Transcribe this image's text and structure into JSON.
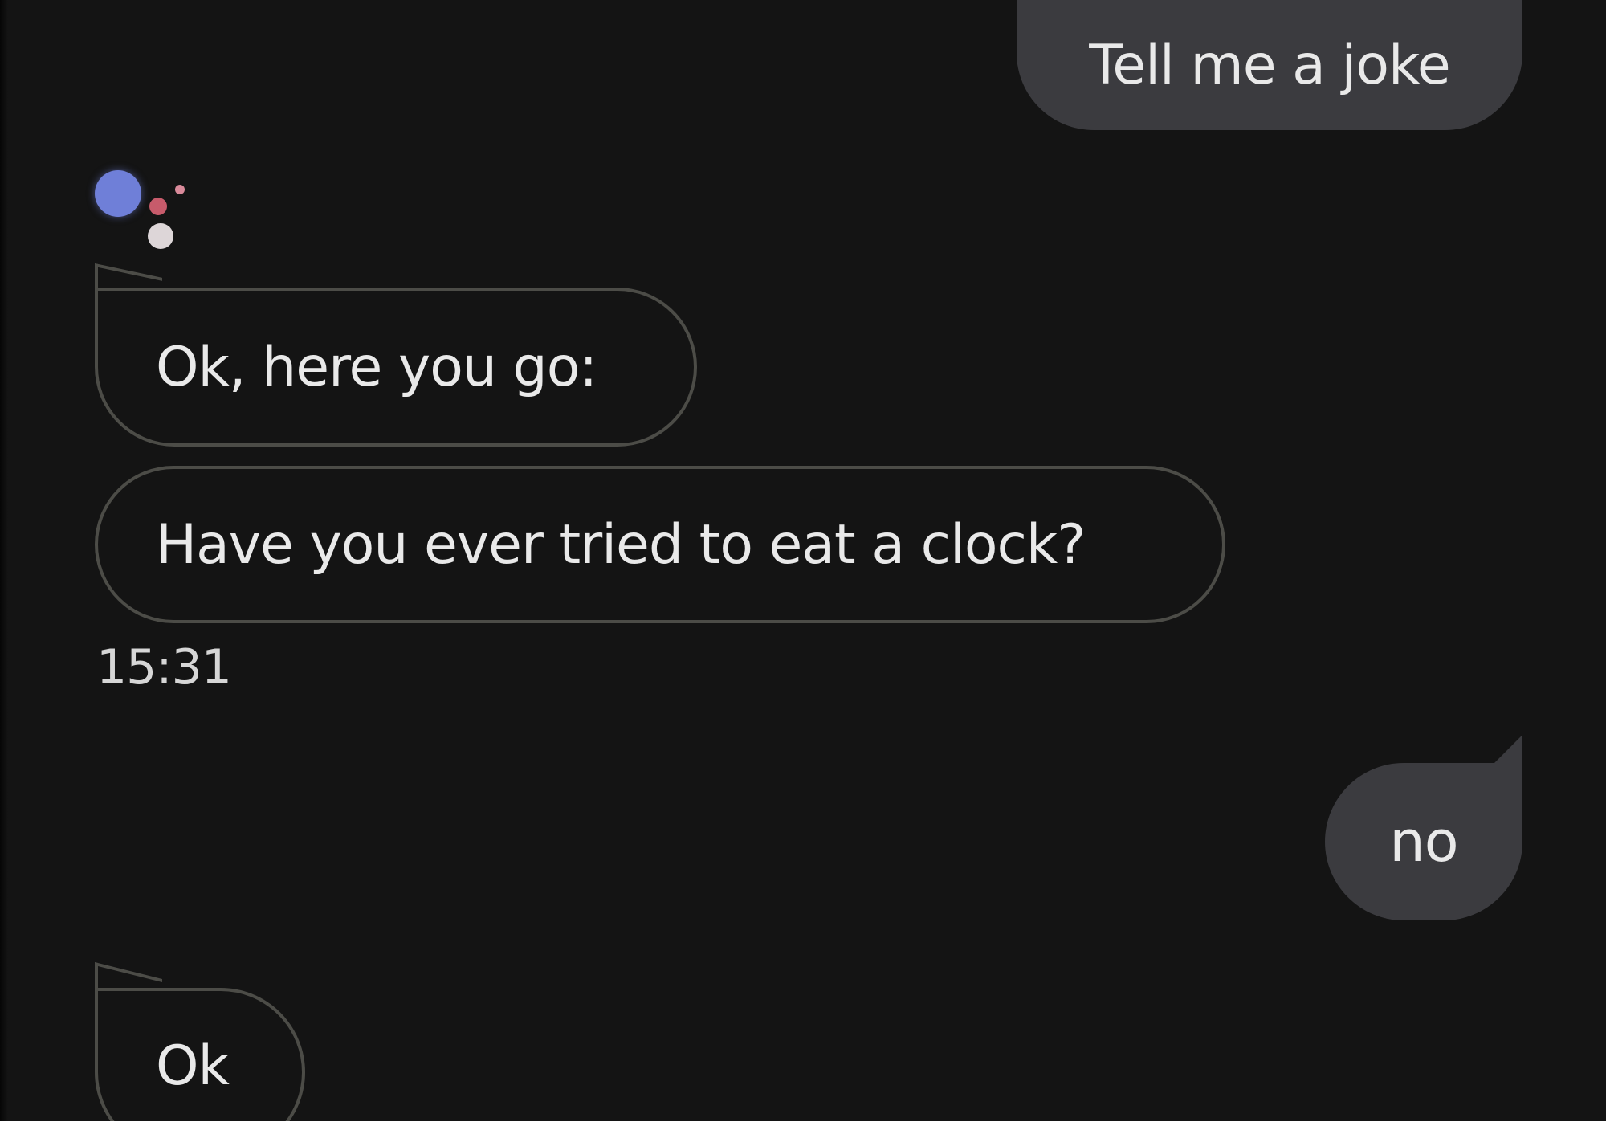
{
  "conversation": {
    "user_message_1": "Tell me a joke",
    "assistant_message_1": "Ok, here you go:",
    "assistant_message_2": "Have you ever tried to eat a clock?",
    "timestamp": "15:31",
    "user_message_2": "no",
    "assistant_message_3": "Ok"
  },
  "icons": {
    "assistant_logo": "google-assistant-icon"
  },
  "colors": {
    "background": "#141414",
    "user_bubble": "#3b3b3f",
    "assistant_bubble_border": "#4c4c47",
    "text": "#e9e9e9",
    "logo_blue": "#6f7fd8",
    "logo_red": "#c75b6b",
    "logo_light": "#ddd6d8"
  }
}
